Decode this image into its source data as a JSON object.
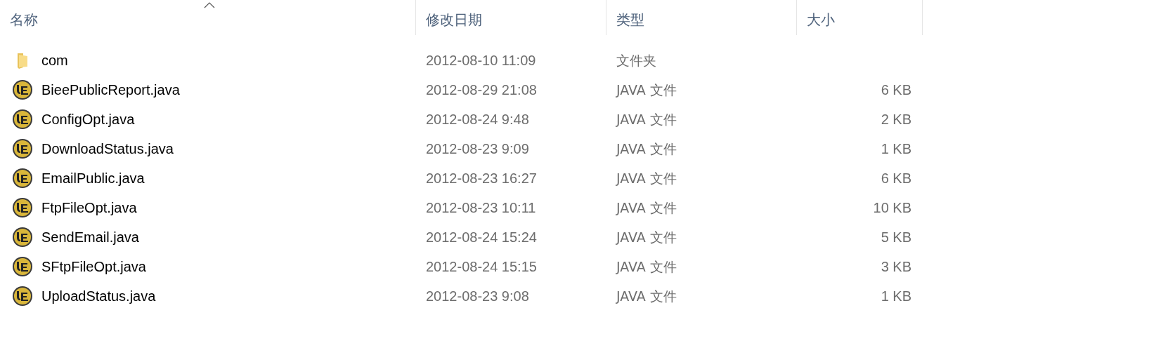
{
  "columns": [
    {
      "label": "名称",
      "sorted": true
    },
    {
      "label": "修改日期",
      "sorted": false
    },
    {
      "label": "类型",
      "sorted": false
    },
    {
      "label": "大小",
      "sorted": false
    }
  ],
  "rows": [
    {
      "kind": "folder",
      "name": "com",
      "modified": "2012-08-10 11:09",
      "type": "文件夹"
    },
    {
      "kind": "file",
      "name": "BieePublicReport.java",
      "modified": "2012-08-29 21:08",
      "type": "JAVA 文件",
      "size": "6 KB"
    },
    {
      "kind": "file",
      "name": "ConfigOpt.java",
      "modified": "2012-08-24 9:48",
      "type": "JAVA 文件",
      "size": "2 KB"
    },
    {
      "kind": "file",
      "name": "DownloadStatus.java",
      "modified": "2012-08-23 9:09",
      "type": "JAVA 文件",
      "size": "1 KB"
    },
    {
      "kind": "file",
      "name": "EmailPublic.java",
      "modified": "2012-08-23 16:27",
      "type": "JAVA 文件",
      "size": "6 KB"
    },
    {
      "kind": "file",
      "name": "FtpFileOpt.java",
      "modified": "2012-08-23 10:11",
      "type": "JAVA 文件",
      "size": "10 KB"
    },
    {
      "kind": "file",
      "name": "SendEmail.java",
      "modified": "2012-08-24 15:24",
      "type": "JAVA 文件",
      "size": "5 KB"
    },
    {
      "kind": "file",
      "name": "SFtpFileOpt.java",
      "modified": "2012-08-24 15:15",
      "type": "JAVA 文件",
      "size": "3 KB"
    },
    {
      "kind": "file",
      "name": "UploadStatus.java",
      "modified": "2012-08-23 9:08",
      "type": "JAVA 文件",
      "size": "1 KB"
    }
  ]
}
